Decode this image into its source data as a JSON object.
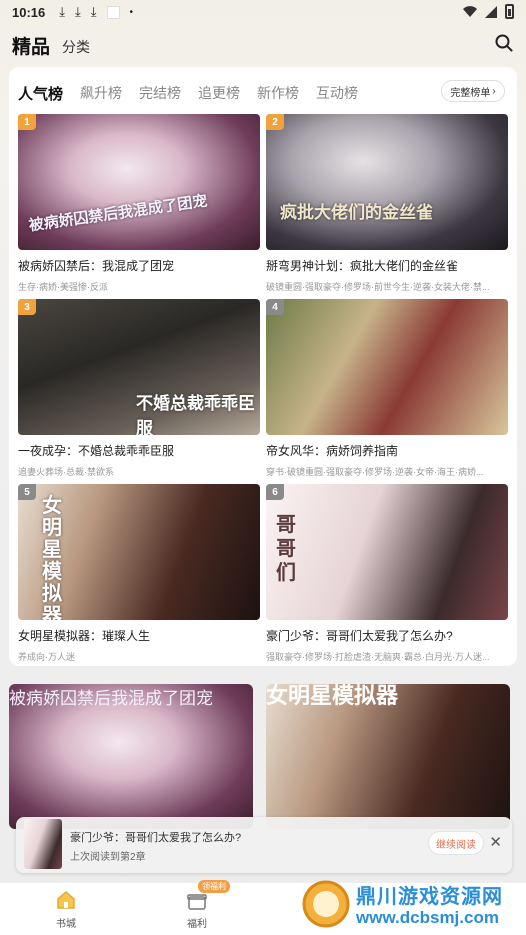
{
  "status_bar": {
    "time": "10:16"
  },
  "top_nav": {
    "featured": "精品",
    "category": "分类"
  },
  "rank_tabs": [
    "人气榜",
    "飙升榜",
    "完结榜",
    "追更榜",
    "新作榜",
    "互动榜"
  ],
  "full_rank_button": "完整榜单",
  "books": [
    {
      "rank": "1",
      "title": "被病娇囚禁后：我混成了团宠",
      "tags": "生存·病娇·美强惨·反派",
      "cover_text": "被病娇囚禁后我混成了团宠"
    },
    {
      "rank": "2",
      "title": "掰弯男神计划：疯批大佬们的金丝雀",
      "tags": "破镜重圆·强取豪夺·修罗场·前世今生·逆袭·女装大佬·禁...",
      "cover_text": "疯批大佬们的金丝雀"
    },
    {
      "rank": "3",
      "title": "一夜成孕：不婚总裁乖乖臣服",
      "tags": "追妻火葬场·总裁·禁欲系",
      "cover_text": "不婚总裁乖乖臣服"
    },
    {
      "rank": "4",
      "title": "帝女风华：病娇饲养指南",
      "tags": "穿书·破镜重圆·强取豪夺·修罗场·逆袭·女帝·海王·病娇...",
      "cover_text": ""
    },
    {
      "rank": "5",
      "title": "女明星模拟器：璀璨人生",
      "tags": "养成向·万人迷",
      "cover_text": "女明星模拟器"
    },
    {
      "rank": "6",
      "title": "豪门少爷：哥哥们太爱我了怎么办?",
      "tags": "强取豪夺·修罗场·打脸虐渣·无脑爽·霸总·白月光·万人迷...",
      "cover_text": "哥哥们"
    }
  ],
  "continue_reading": {
    "title": "豪门少爷：哥哥们太爱我了怎么办?",
    "subtitle": "上次阅读到第2章",
    "button": "继续阅读"
  },
  "bottom_nav": {
    "bookstore": "书城",
    "welfare": "福利",
    "welfare_badge": "领福利"
  },
  "watermark": {
    "line1": "鼎川游戏资源网",
    "line2": "www.dcbsmj.com"
  },
  "colors": {
    "accent": "#f0a048",
    "rank_badge": "#f2a23a",
    "button_text": "#e26a46"
  }
}
